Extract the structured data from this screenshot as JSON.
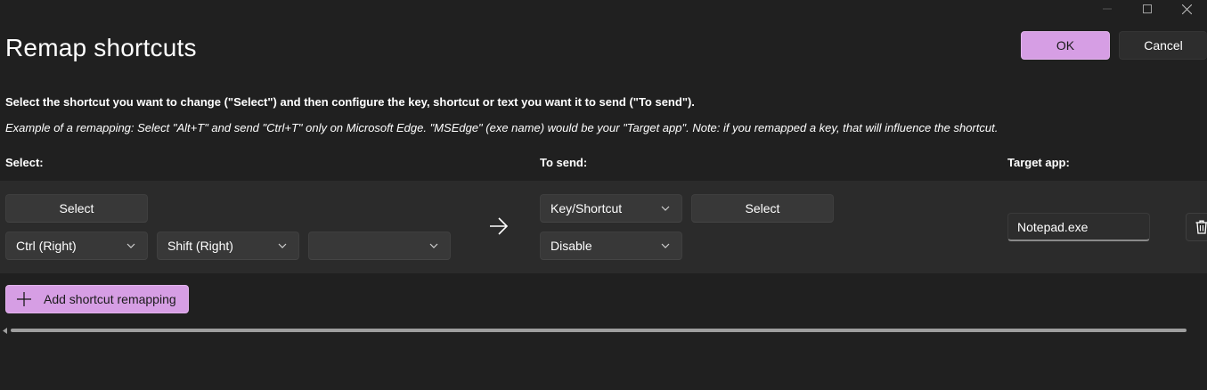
{
  "window": {
    "caption_buttons": [
      "minimize-icon",
      "maximize-icon",
      "close-icon"
    ]
  },
  "header": {
    "title": "Remap shortcuts",
    "ok_label": "OK",
    "cancel_label": "Cancel"
  },
  "instructions": {
    "main": "Select the shortcut you want to change (\"Select\") and then configure the key, shortcut or text you want it to send (\"To send\").",
    "example": "Example of a remapping: Select \"Alt+T\" and send \"Ctrl+T\" only on Microsoft Edge. \"MSEdge\" (exe name) would be your \"Target app\". Note: if you remapped a key, that will influence the shortcut."
  },
  "columns": {
    "select": "Select:",
    "to_send": "To send:",
    "target_app": "Target app:"
  },
  "row": {
    "select_button": "Select",
    "key1": "Ctrl (Right)",
    "key2": "Shift (Right)",
    "key3": "",
    "arrow_icon": "arrow-right-icon",
    "send_type": "Key/Shortcut",
    "send_select_button": "Select",
    "send_value": "Disable",
    "target_app": "Notepad.exe",
    "delete_icon": "trash-icon"
  },
  "footer": {
    "add_label": "Add shortcut remapping"
  },
  "colors": {
    "accent": "#d69ee4",
    "background": "#202020",
    "row_background": "#2b2b2b"
  }
}
